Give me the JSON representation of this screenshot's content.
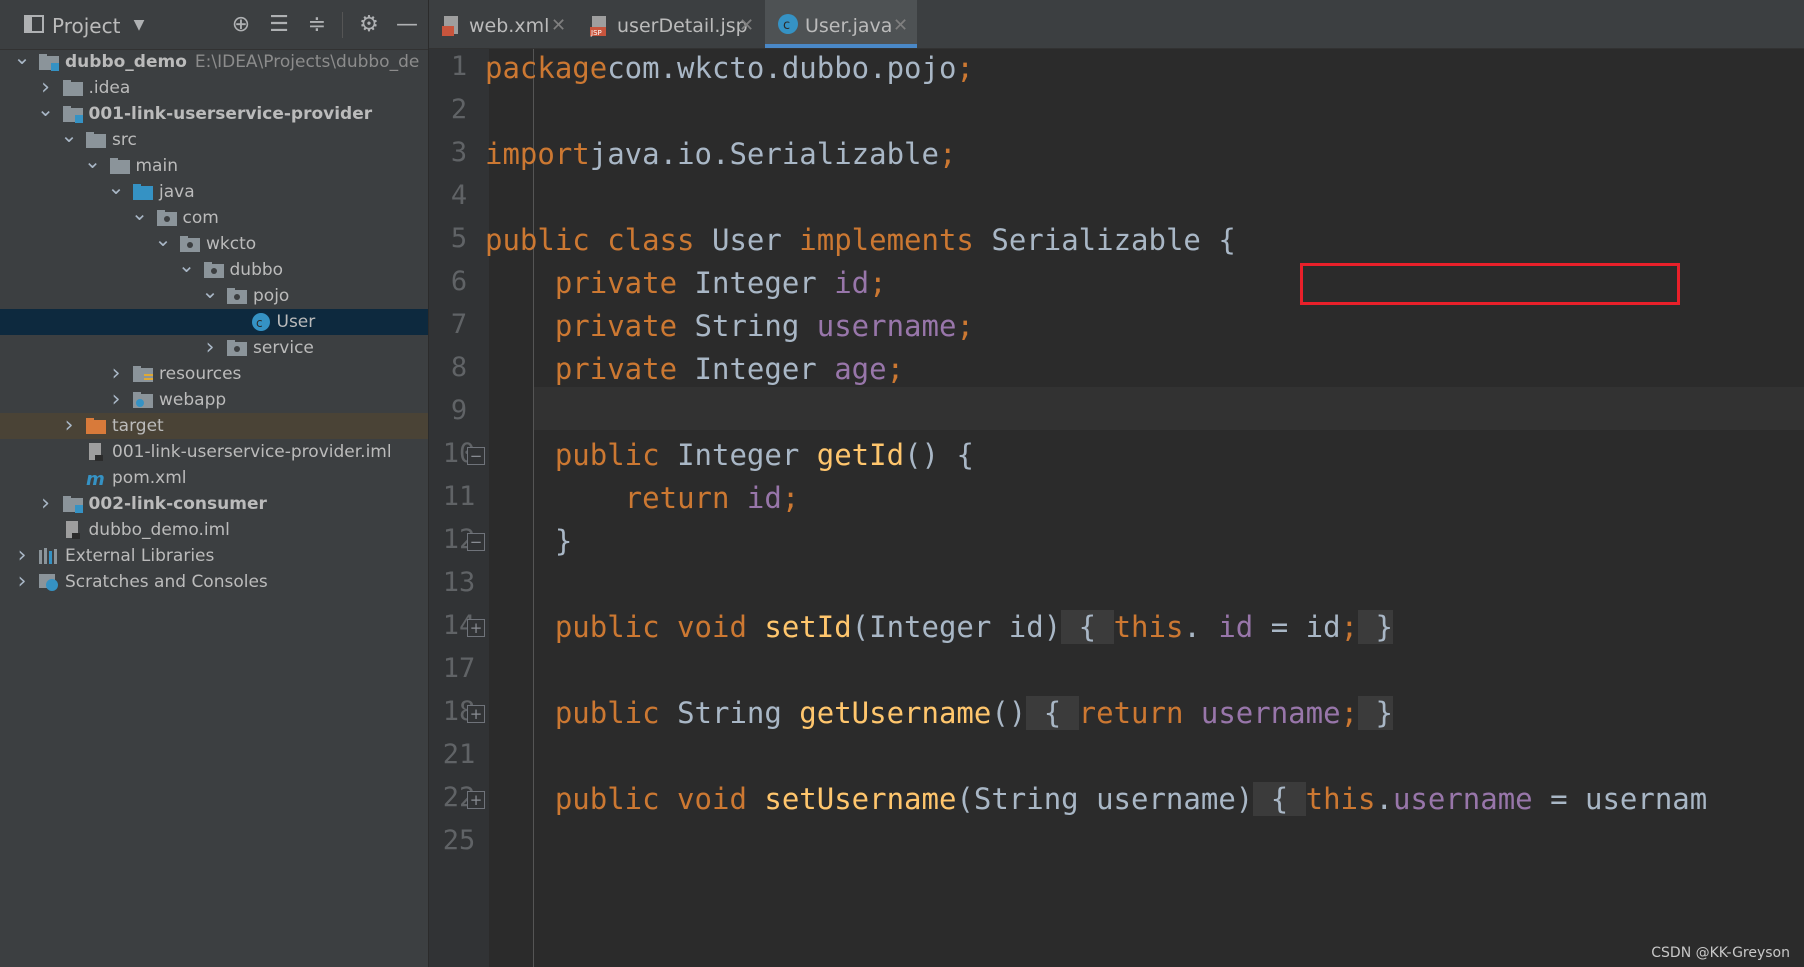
{
  "sidebar": {
    "title": "Project",
    "toolbar_icons": [
      "locate-icon",
      "expand-all-icon",
      "collapse-all-icon",
      "gear-icon",
      "minimize-icon"
    ],
    "tree": [
      {
        "label": "dubbo_demo",
        "path": "E:\\IDEA\\Projects\\dubbo_de",
        "bold": true,
        "expanded": true,
        "icon": "module-folder"
      },
      {
        "label": ".idea",
        "expanded": false,
        "icon": "folder"
      },
      {
        "label": "001-link-userservice-provider",
        "bold": true,
        "expanded": true,
        "icon": "module-folder"
      },
      {
        "label": "src",
        "expanded": true,
        "icon": "folder"
      },
      {
        "label": "main",
        "expanded": true,
        "icon": "folder"
      },
      {
        "label": "java",
        "expanded": true,
        "icon": "source-folder"
      },
      {
        "label": "com",
        "expanded": true,
        "icon": "package"
      },
      {
        "label": "wkcto",
        "expanded": true,
        "icon": "package"
      },
      {
        "label": "dubbo",
        "expanded": true,
        "icon": "package"
      },
      {
        "label": "pojo",
        "expanded": true,
        "icon": "package"
      },
      {
        "label": "User",
        "icon": "class",
        "selected": true
      },
      {
        "label": "service",
        "expanded": false,
        "icon": "package"
      },
      {
        "label": "resources",
        "expanded": false,
        "icon": "resources-folder"
      },
      {
        "label": "webapp",
        "expanded": false,
        "icon": "web-folder"
      },
      {
        "label": "target",
        "expanded": false,
        "icon": "excluded-folder",
        "excluded": true
      },
      {
        "label": "001-link-userservice-provider.iml",
        "icon": "iml-file"
      },
      {
        "label": "pom.xml",
        "icon": "maven-file"
      },
      {
        "label": "002-link-consumer",
        "bold": true,
        "expanded": false,
        "icon": "module-folder"
      },
      {
        "label": "dubbo_demo.iml",
        "icon": "iml-file"
      },
      {
        "label": "External Libraries",
        "expanded": false,
        "icon": "libraries"
      },
      {
        "label": "Scratches and Consoles",
        "expanded": false,
        "icon": "scratches"
      }
    ]
  },
  "tabs": [
    {
      "label": "web.xml",
      "icon": "xml-file-icon",
      "active": false
    },
    {
      "label": "userDetail.jsp",
      "icon": "jsp-file-icon",
      "active": false
    },
    {
      "label": "User.java",
      "icon": "class-icon",
      "active": true
    }
  ],
  "editor": {
    "lines": [
      {
        "num": "1",
        "tokens": [
          [
            "kw",
            "package"
          ],
          [
            "",
            "com.wkcto.dubbo.pojo"
          ],
          [
            "kw",
            ";"
          ]
        ]
      },
      {
        "num": "2",
        "tokens": []
      },
      {
        "num": "3",
        "tokens": [
          [
            "kw",
            "import"
          ],
          [
            "",
            "java.io.Serializable"
          ],
          [
            "kw",
            ";"
          ]
        ]
      },
      {
        "num": "4",
        "tokens": []
      },
      {
        "num": "5",
        "tokens": [
          [
            "kw",
            "public class "
          ],
          [
            "",
            "User "
          ],
          [
            "kw",
            "implements "
          ],
          [
            "",
            "Serializable "
          ],
          [
            "",
            "{"
          ]
        ]
      },
      {
        "num": "6",
        "tokens": [
          [
            "",
            "    "
          ],
          [
            "kw",
            "private "
          ],
          [
            "",
            "Integer "
          ],
          [
            "fld",
            "id"
          ],
          [
            "kw",
            ";"
          ]
        ]
      },
      {
        "num": "7",
        "tokens": [
          [
            "",
            "    "
          ],
          [
            "kw",
            "private "
          ],
          [
            "",
            "String "
          ],
          [
            "fld",
            "username"
          ],
          [
            "kw",
            ";"
          ]
        ]
      },
      {
        "num": "8",
        "tokens": [
          [
            "",
            "    "
          ],
          [
            "kw",
            "private "
          ],
          [
            "",
            "Integer "
          ],
          [
            "fld",
            "age"
          ],
          [
            "kw",
            ";"
          ]
        ]
      },
      {
        "num": "9",
        "tokens": []
      },
      {
        "num": "10",
        "tokens": [
          [
            "",
            "    "
          ],
          [
            "kw",
            "public "
          ],
          [
            "",
            "Integer "
          ],
          [
            "meth",
            "getId"
          ],
          [
            "",
            "() {"
          ]
        ]
      },
      {
        "num": "11",
        "tokens": [
          [
            "",
            "        "
          ],
          [
            "kw",
            "return "
          ],
          [
            "fld",
            "id"
          ],
          [
            "kw",
            ";"
          ]
        ]
      },
      {
        "num": "12",
        "tokens": [
          [
            "",
            "    }"
          ]
        ]
      },
      {
        "num": "13",
        "tokens": []
      },
      {
        "num": "14",
        "tokens": [
          [
            "",
            "    "
          ],
          [
            "kw",
            "public void "
          ],
          [
            "meth",
            "setId"
          ],
          [
            "",
            "(Integer id)"
          ],
          [
            "brace",
            " { "
          ],
          [
            "kw",
            "this"
          ],
          [
            "",
            ". "
          ],
          [
            "fld",
            "id"
          ],
          [
            "",
            " = id"
          ],
          [
            "kw",
            ";"
          ],
          [
            "brace",
            " }"
          ]
        ]
      },
      {
        "num": "17",
        "tokens": []
      },
      {
        "num": "18",
        "tokens": [
          [
            "",
            "    "
          ],
          [
            "kw",
            "public "
          ],
          [
            "",
            "String "
          ],
          [
            "meth",
            "getUsername"
          ],
          [
            "",
            "()"
          ],
          [
            "brace",
            " { "
          ],
          [
            "kw",
            "return "
          ],
          [
            "fld",
            "username"
          ],
          [
            "kw",
            ";"
          ],
          [
            "brace",
            " }"
          ]
        ]
      },
      {
        "num": "21",
        "tokens": []
      },
      {
        "num": "22",
        "tokens": [
          [
            "",
            "    "
          ],
          [
            "kw",
            "public void "
          ],
          [
            "meth",
            "setUsername"
          ],
          [
            "",
            "(String username)"
          ],
          [
            "brace",
            " { "
          ],
          [
            "kw",
            "this"
          ],
          [
            "",
            "."
          ],
          [
            "fld",
            "username"
          ],
          [
            "",
            " = usernam"
          ]
        ]
      },
      {
        "num": "25",
        "tokens": []
      }
    ],
    "fold_markers": [
      "10",
      "12",
      "14",
      "18",
      "22"
    ]
  },
  "watermark": "CSDN @KK-Greyson",
  "colors": {
    "keyword": "#cc7832",
    "field": "#9876aa",
    "method": "#ffc66d",
    "text": "#a9b7c6",
    "highlight_box": "#e8202a"
  }
}
